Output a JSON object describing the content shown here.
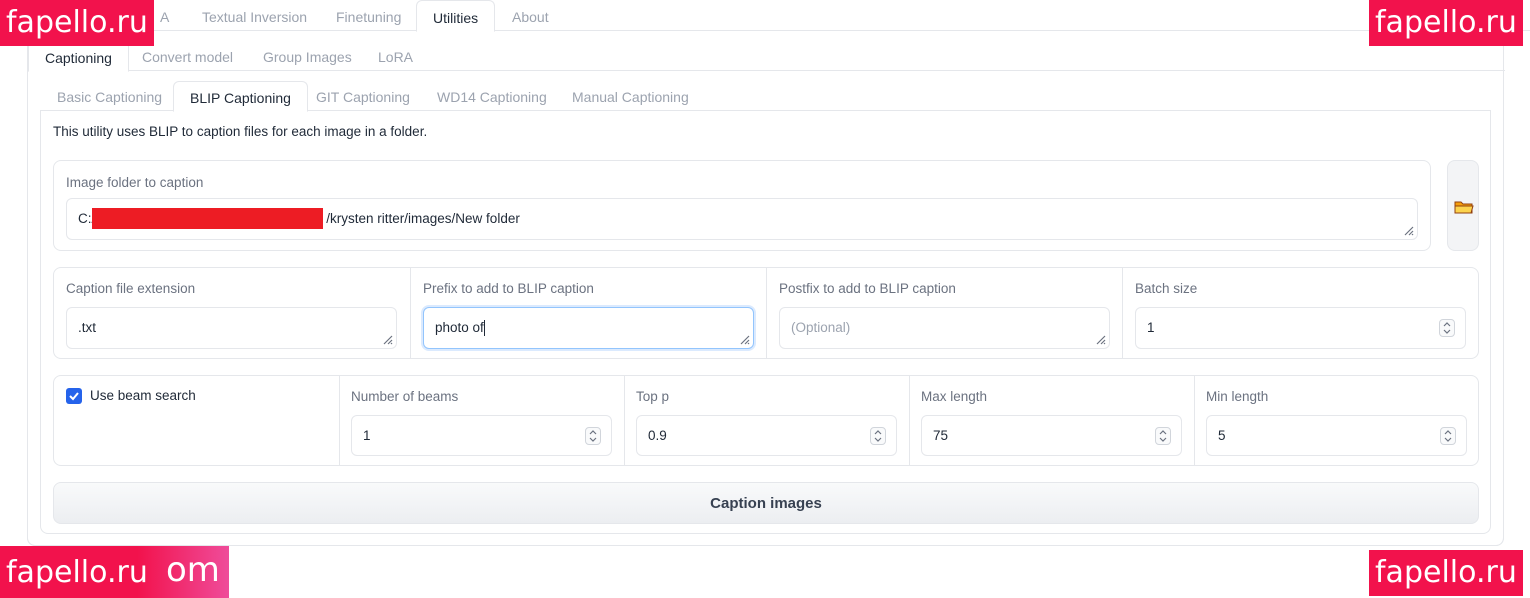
{
  "top_tabs": [
    "A",
    "Textual Inversion",
    "Finetuning",
    "Utilities",
    "About"
  ],
  "utility_tabs": [
    "Captioning",
    "Convert model",
    "Group Images",
    "LoRA"
  ],
  "captioning_tabs": [
    "Basic Captioning",
    "BLIP Captioning",
    "GIT Captioning",
    "WD14 Captioning",
    "Manual Captioning"
  ],
  "description": "This utility uses BLIP to caption files for each image in a folder.",
  "image_folder": {
    "label": "Image folder to caption",
    "prefix": "C:/",
    "suffix": "/krysten ritter/images/New folder"
  },
  "folder_button": {
    "icon": "folder-icon"
  },
  "caption_ext": {
    "label": "Caption file extension",
    "value": ".txt"
  },
  "prefix": {
    "label": "Prefix to add to BLIP caption",
    "value": "photo of"
  },
  "postfix": {
    "label": "Postfix to add to BLIP caption",
    "placeholder": "(Optional)"
  },
  "batch_size": {
    "label": "Batch size",
    "value": "1"
  },
  "beam_search": {
    "label": "Use beam search",
    "checked": true
  },
  "num_beams": {
    "label": "Number of beams",
    "value": "1"
  },
  "top_p": {
    "label": "Top p",
    "value": "0.9"
  },
  "max_length": {
    "label": "Max length",
    "value": "75"
  },
  "min_length": {
    "label": "Min length",
    "value": "5"
  },
  "caption_button": "Caption images",
  "watermarks": [
    "fapello.ru",
    "fapello.ru",
    "fapello.ru",
    "om",
    "fapello.ru"
  ],
  "colors": {
    "accent": "#2563eb",
    "watermark": "#f2124c",
    "redaction": "#ed1c24"
  }
}
